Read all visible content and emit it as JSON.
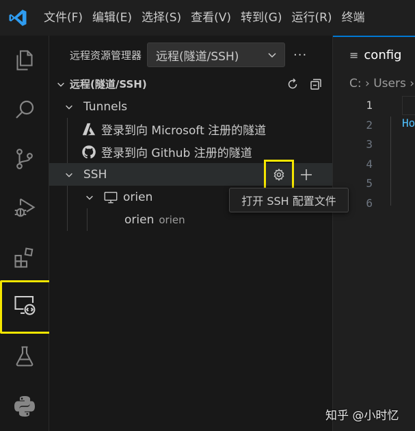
{
  "titlebar": {
    "logo_icon": "vscode-logo-icon",
    "menu": [
      "文件(F)",
      "编辑(E)",
      "选择(S)",
      "查看(V)",
      "转到(G)",
      "运行(R)",
      "终端"
    ]
  },
  "activitybar": {
    "items": [
      {
        "icon": "explorer-icon"
      },
      {
        "icon": "search-icon"
      },
      {
        "icon": "source-control-icon"
      },
      {
        "icon": "run-debug-icon"
      },
      {
        "icon": "extensions-icon"
      },
      {
        "icon": "remote-explorer-icon",
        "active": true
      },
      {
        "icon": "testing-icon"
      },
      {
        "icon": "python-icon"
      }
    ]
  },
  "sidebar": {
    "title": "远程资源管理器",
    "dropdown_value": "远程(隧道/SSH)",
    "more": "···",
    "section_title": "远程(隧道/SSH)",
    "tunnels_label": "Tunnels",
    "tunnel_microsoft": "登录到向 Microsoft 注册的隧道",
    "tunnel_github": "登录到向 Github 注册的隧道",
    "ssh_label": "SSH",
    "host_name": "orien",
    "folder_name": "orien",
    "folder_desc": "orien",
    "tooltip": "打开 SSH 配置文件"
  },
  "editor": {
    "tab_label": "config",
    "tab_icon": "≡",
    "breadcrumb": "C: › Users ›",
    "line_numbers": [
      "1",
      "2",
      "3",
      "4",
      "5",
      "6"
    ],
    "code_token": "Ho"
  },
  "watermark": "知乎 @小时忆",
  "colors": {
    "accent_highlight": "#f5e600",
    "tab_accent": "#0078d4",
    "background": "#181818"
  }
}
